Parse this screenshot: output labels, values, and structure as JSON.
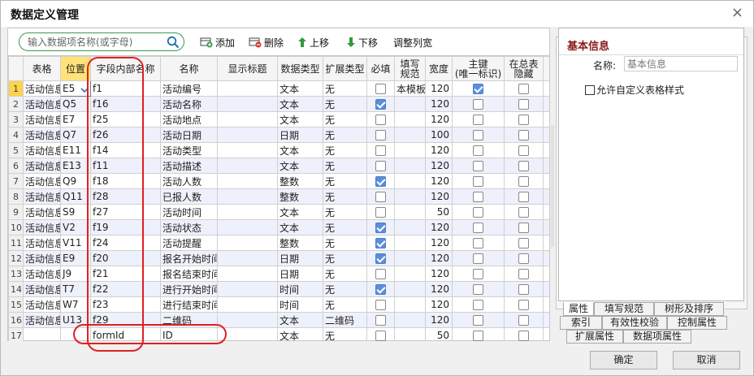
{
  "window": {
    "title": "数据定义管理",
    "close_glyph": "×"
  },
  "search": {
    "placeholder": "输入数据项名称(或字母)"
  },
  "toolbar": {
    "add": "添加",
    "delete": "删除",
    "up": "上移",
    "down": "下移",
    "adjust": "调整列宽"
  },
  "table": {
    "headers": [
      "表格",
      "位置",
      "字段内部名称",
      "名称",
      "显示标题",
      "数据类型",
      "扩展类型",
      "必填",
      "填写规范",
      "宽度",
      "主键\n(唯一标识)",
      "在总表\n隐藏",
      "格"
    ],
    "rows": [
      {
        "n": "1",
        "table": "活动信息",
        "pos": "E5",
        "field": "f1",
        "name": "活动编号",
        "title": "",
        "dtype": "文本",
        "ext": "无",
        "required": false,
        "rule": "本模板",
        "width": "120",
        "pk": true,
        "hidden": false
      },
      {
        "n": "2",
        "table": "活动信息",
        "pos": "Q5",
        "field": "f16",
        "name": "活动名称",
        "title": "",
        "dtype": "文本",
        "ext": "无",
        "required": true,
        "rule": "",
        "width": "120",
        "pk": false,
        "hidden": false
      },
      {
        "n": "3",
        "table": "活动信息",
        "pos": "E7",
        "field": "f25",
        "name": "活动地点",
        "title": "",
        "dtype": "文本",
        "ext": "无",
        "required": false,
        "rule": "",
        "width": "120",
        "pk": false,
        "hidden": false
      },
      {
        "n": "4",
        "table": "活动信息",
        "pos": "Q7",
        "field": "f26",
        "name": "活动日期",
        "title": "",
        "dtype": "日期",
        "ext": "无",
        "required": false,
        "rule": "",
        "width": "100",
        "pk": false,
        "hidden": false
      },
      {
        "n": "5",
        "table": "活动信息",
        "pos": "E11",
        "field": "f14",
        "name": "活动类型",
        "title": "",
        "dtype": "文本",
        "ext": "无",
        "required": false,
        "rule": "",
        "width": "120",
        "pk": false,
        "hidden": false
      },
      {
        "n": "6",
        "table": "活动信息",
        "pos": "E13",
        "field": "f11",
        "name": "活动描述",
        "title": "",
        "dtype": "文本",
        "ext": "无",
        "required": false,
        "rule": "",
        "width": "120",
        "pk": false,
        "hidden": false
      },
      {
        "n": "7",
        "table": "活动信息",
        "pos": "Q9",
        "field": "f18",
        "name": "活动人数",
        "title": "",
        "dtype": "整数",
        "ext": "无",
        "required": true,
        "rule": "",
        "width": "120",
        "pk": false,
        "hidden": false
      },
      {
        "n": "8",
        "table": "活动信息",
        "pos": "Q11",
        "field": "f28",
        "name": "已报人数",
        "title": "",
        "dtype": "整数",
        "ext": "无",
        "required": false,
        "rule": "",
        "width": "120",
        "pk": false,
        "hidden": false
      },
      {
        "n": "9",
        "table": "活动信息",
        "pos": "S9",
        "field": "f27",
        "name": "活动时间",
        "title": "",
        "dtype": "文本",
        "ext": "无",
        "required": false,
        "rule": "",
        "width": "50",
        "pk": false,
        "hidden": false
      },
      {
        "n": "10",
        "table": "活动信息",
        "pos": "V2",
        "field": "f19",
        "name": "活动状态",
        "title": "",
        "dtype": "文本",
        "ext": "无",
        "required": true,
        "rule": "",
        "width": "120",
        "pk": false,
        "hidden": false
      },
      {
        "n": "11",
        "table": "活动信息",
        "pos": "V11",
        "field": "f24",
        "name": "活动提醒",
        "title": "",
        "dtype": "整数",
        "ext": "无",
        "required": true,
        "rule": "",
        "width": "120",
        "pk": false,
        "hidden": false
      },
      {
        "n": "12",
        "table": "活动信息",
        "pos": "E9",
        "field": "f20",
        "name": "报名开始时间",
        "title": "",
        "dtype": "日期",
        "ext": "无",
        "required": true,
        "rule": "",
        "width": "120",
        "pk": false,
        "hidden": false
      },
      {
        "n": "13",
        "table": "活动信息",
        "pos": "J9",
        "field": "f21",
        "name": "报名结束时间",
        "title": "",
        "dtype": "日期",
        "ext": "无",
        "required": false,
        "rule": "",
        "width": "120",
        "pk": false,
        "hidden": false
      },
      {
        "n": "14",
        "table": "活动信息",
        "pos": "T7",
        "field": "f22",
        "name": "进行开始时间",
        "title": "",
        "dtype": "时间",
        "ext": "无",
        "required": true,
        "rule": "",
        "width": "120",
        "pk": false,
        "hidden": false
      },
      {
        "n": "15",
        "table": "活动信息",
        "pos": "W7",
        "field": "f23",
        "name": "进行结束时间",
        "title": "",
        "dtype": "时间",
        "ext": "无",
        "required": false,
        "rule": "",
        "width": "120",
        "pk": false,
        "hidden": false
      },
      {
        "n": "16",
        "table": "活动信息",
        "pos": "U13",
        "field": "f29",
        "name": "二维码",
        "title": "",
        "dtype": "文本",
        "ext": "二维码",
        "required": false,
        "rule": "",
        "width": "120",
        "pk": false,
        "hidden": false
      },
      {
        "n": "17",
        "table": "",
        "pos": "",
        "field": "formId",
        "name": "ID",
        "title": "",
        "dtype": "文本",
        "ext": "无",
        "required": false,
        "rule": "",
        "width": "50",
        "pk": false,
        "hidden": false
      }
    ]
  },
  "right_panel": {
    "section_title": "基本信息",
    "name_label": "名称:",
    "name_value": "基本信息",
    "custom_style_label": "允许自定义表格样式",
    "tabs": [
      "属性",
      "填写规范",
      "树形及排序",
      "索引",
      "有效性校验",
      "控制属性",
      "扩展属性",
      "数据项属性"
    ]
  },
  "buttons": {
    "ok": "确定",
    "cancel": "取消"
  },
  "colors": {
    "selected_header": "#ffe27a",
    "alt_row": "#eef0fb",
    "checkbox_on": "#5b8fdc",
    "annotation": "#e02020",
    "section_title": "#8b1a1a"
  }
}
